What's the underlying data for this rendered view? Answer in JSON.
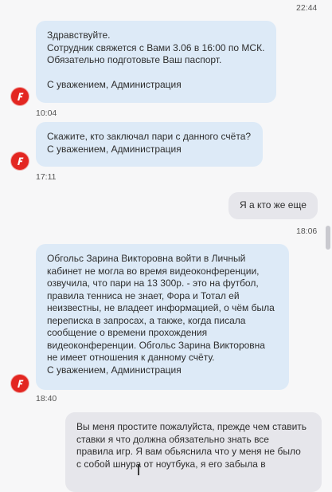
{
  "messages": [
    {
      "lines": [
        "Здравствуйте.",
        "Сотрудник свяжется с Вами 3.06 в 16:00 по МСК.",
        "Обязательно подготовьте Ваш паспорт.",
        "",
        "С уважением, Администрация"
      ],
      "time": "10:04",
      "direction": "incoming"
    },
    {
      "lines": [
        "Скажите, кто заключал пари с данного счёта?",
        "С уважением, Администрация"
      ],
      "time": "17:11",
      "direction": "incoming"
    },
    {
      "lines": [
        "Я а кто же еще"
      ],
      "time": "18:06",
      "direction": "outgoing"
    },
    {
      "lines": [
        "Обгольс Зарина Викторовна войти в Личный",
        "кабинет не могла во время видеоконференции,",
        "озвучила, что пари на 13 300р. - это на футбол,",
        "правила тенниса не знает, Фора и Тотал ей",
        "неизвестны, не владеет информацией, о чём была",
        "переписка в запросах, а также, когда писала",
        "сообщение о времени прохождения",
        "видеоконференции. Обгольс Зарина Викторовна",
        "не имеет отношения к данному счёту.",
        "С уважением, Администрация"
      ],
      "time": "18:40",
      "direction": "incoming"
    },
    {
      "lines": [
        "Вы меня простите пожалуйста, прежде чем ставить",
        "ставки я что должна обязательно знать все",
        "правила игр. Я вам обьяснила что у меня не было",
        "с собой шнура от ноутбука, я его забыла в"
      ],
      "direction": "outgoing"
    }
  ],
  "top_time": "22:44",
  "colors": {
    "incoming_bubble": "#ddeaf7",
    "outgoing_bubble": "#e6e6eb",
    "avatar": "#e32621",
    "background": "#f7f7f8"
  },
  "icons": {
    "avatar": "bookmaker-logo-f-icon"
  }
}
